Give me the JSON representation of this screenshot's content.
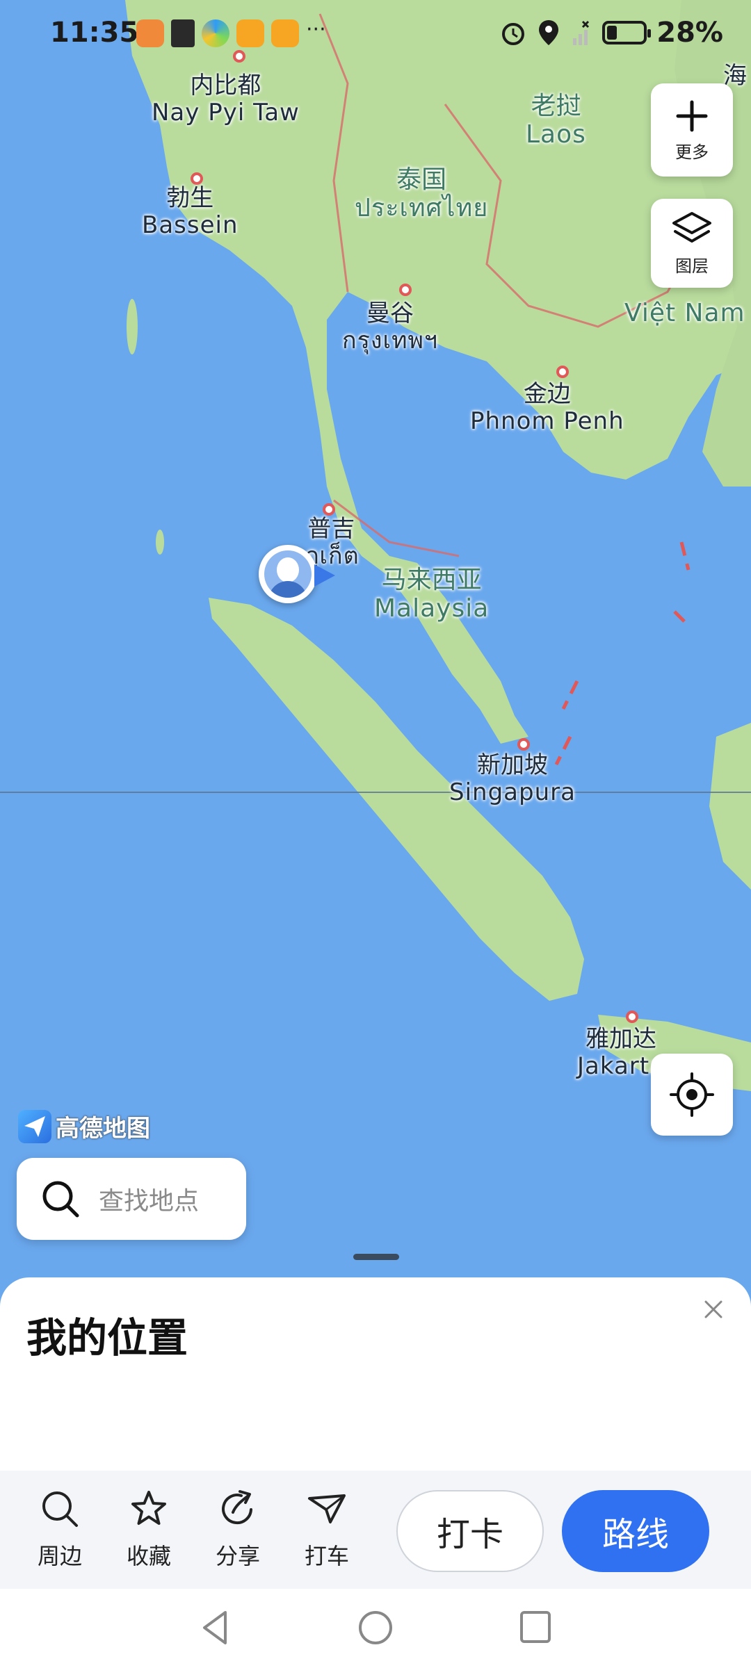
{
  "status_bar": {
    "time": "11:35",
    "battery": "28%"
  },
  "map": {
    "labels": [
      {
        "zh": "内比都",
        "en": "Nay Pyi Taw"
      },
      {
        "zh": "勃生",
        "en": "Bassein"
      },
      {
        "zh": "老挝",
        "en": "Laos"
      },
      {
        "zh": "泰国",
        "en": "ประเทศไทย"
      },
      {
        "zh": "曼谷",
        "en": "กรุงเทพฯ"
      },
      {
        "zh": "",
        "en": "Việt Nam"
      },
      {
        "zh": "金边",
        "en": "Phnom Penh"
      },
      {
        "zh": "普吉",
        "en": "ภูเก็ต"
      },
      {
        "zh": "马来西亚",
        "en": "Malaysia"
      },
      {
        "zh": "新加坡",
        "en": "Singapura"
      },
      {
        "zh": "雅加达",
        "en": "Jakarta"
      },
      {
        "zh": "海",
        "en": ""
      }
    ],
    "logo": "高德地图"
  },
  "controls": {
    "more_label": "更多",
    "layers_label": "图层"
  },
  "search": {
    "placeholder": "查找地点"
  },
  "sheet": {
    "title": "我的位置"
  },
  "actions": {
    "nearby": "周边",
    "favorite": "收藏",
    "share": "分享",
    "taxi": "打车",
    "checkin": "打卡",
    "route": "路线"
  },
  "colors": {
    "sea": "#6aa8ee",
    "land": "#b9dc9d",
    "accent": "#2f71f1",
    "border": "#d86a6a"
  }
}
